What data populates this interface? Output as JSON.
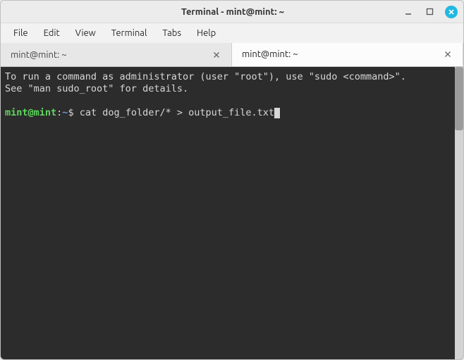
{
  "window": {
    "title": "Terminal - mint@mint: ~"
  },
  "menu": {
    "items": [
      "File",
      "Edit",
      "View",
      "Terminal",
      "Tabs",
      "Help"
    ]
  },
  "tabs": [
    {
      "label": "mint@mint: ~",
      "active": false
    },
    {
      "label": "mint@mint: ~",
      "active": true
    }
  ],
  "terminal": {
    "motd_line1": "To run a command as administrator (user \"root\"), use \"sudo <command>\".",
    "motd_line2": "See \"man sudo_root\" for details.",
    "prompt": {
      "user_host": "mint@mint",
      "sep": ":",
      "path": "~",
      "symbol": "$"
    },
    "command": "cat dog_folder/* > output_file.txt"
  }
}
